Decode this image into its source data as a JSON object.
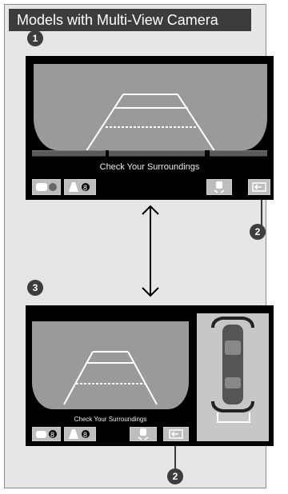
{
  "header": {
    "title": "Models with Multi-View Camera"
  },
  "markers": {
    "m1": "1",
    "m2a": "2",
    "m3": "3",
    "m2b": "2"
  },
  "screen_top": {
    "caption": "Check Your Surroundings"
  },
  "screen_bottom": {
    "caption": "Check Your Surroundings"
  },
  "icons": {
    "camera_mode": "camera-icon",
    "person": "person-icon",
    "view_toggle": "car-view-icon",
    "exit": "exit-arrow-icon",
    "swap": "double-arrow-icon",
    "top_view": "car-top-view-icon"
  }
}
